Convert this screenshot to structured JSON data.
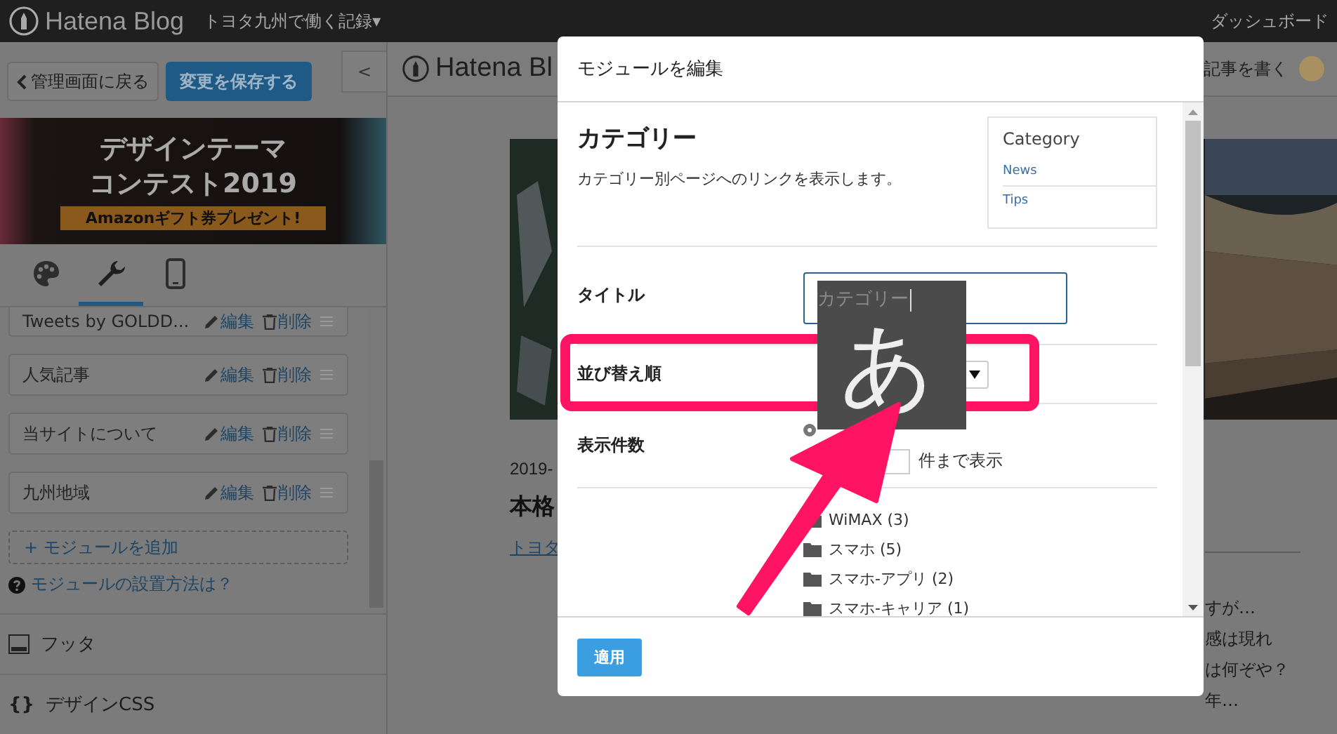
{
  "topbar": {
    "logo": "Hatena Blog",
    "blog_title": "トヨタ九州で働く記録▾",
    "dashboard": "ダッシュボード"
  },
  "sidebar": {
    "back_button": "管理画面に戻る",
    "save_button": "変更を保存する",
    "collapse": "<",
    "banner": {
      "line1": "デザインテーマ",
      "line2": "コンテスト2019",
      "ribbon": "Amazonギフト券プレゼント!"
    },
    "tabs": [
      {
        "kind": "palette",
        "selected": false
      },
      {
        "kind": "wrench",
        "selected": true
      },
      {
        "kind": "phone",
        "selected": false
      }
    ],
    "modules": [
      {
        "name": "Tweets by GOLDD...",
        "edit": "編集",
        "delete": "削除"
      },
      {
        "name": "人気記事",
        "edit": "編集",
        "delete": "削除"
      },
      {
        "name": "当サイトについて",
        "edit": "編集",
        "delete": "削除"
      },
      {
        "name": "九州地域",
        "edit": "編集",
        "delete": "削除"
      }
    ],
    "add_module": "+ モジュールを追加",
    "help": "モジュールの設置方法は？",
    "sections": [
      {
        "kind": "footer",
        "label": "フッタ"
      },
      {
        "kind": "css",
        "icon_text": "{}",
        "label": "デザインCSS"
      }
    ]
  },
  "preview": {
    "logo": "Hatena Bl",
    "write_button": "記事を書く",
    "date": "2019-",
    "title": "本格",
    "link": "トヨタ",
    "excerpt": [
      "すが…",
      "感は現れ",
      "は何ぞや？",
      "年…"
    ]
  },
  "modal": {
    "title": "モジュールを編集",
    "module_name": "カテゴリー",
    "description": "カテゴリー別ページへのリンクを表示します。",
    "sample": {
      "heading": "Category",
      "links": [
        "News",
        "Tips"
      ]
    },
    "fields": [
      {
        "kind": "text",
        "label": "タイトル"
      },
      {
        "kind": "select",
        "label": "並び替え順"
      },
      {
        "kind": "count",
        "label": "表示件数",
        "radios": [
          {
            "selected": true
          }
        ],
        "suffix": "件まで表示"
      }
    ],
    "categories": [
      "WiMAX (3)",
      "スマホ (5)",
      "スマホ-アプリ (2)",
      "スマホ-キャリア (1)"
    ],
    "apply_button": "適用"
  },
  "ime": {
    "composition": "カテゴリー",
    "mode": "あ"
  }
}
